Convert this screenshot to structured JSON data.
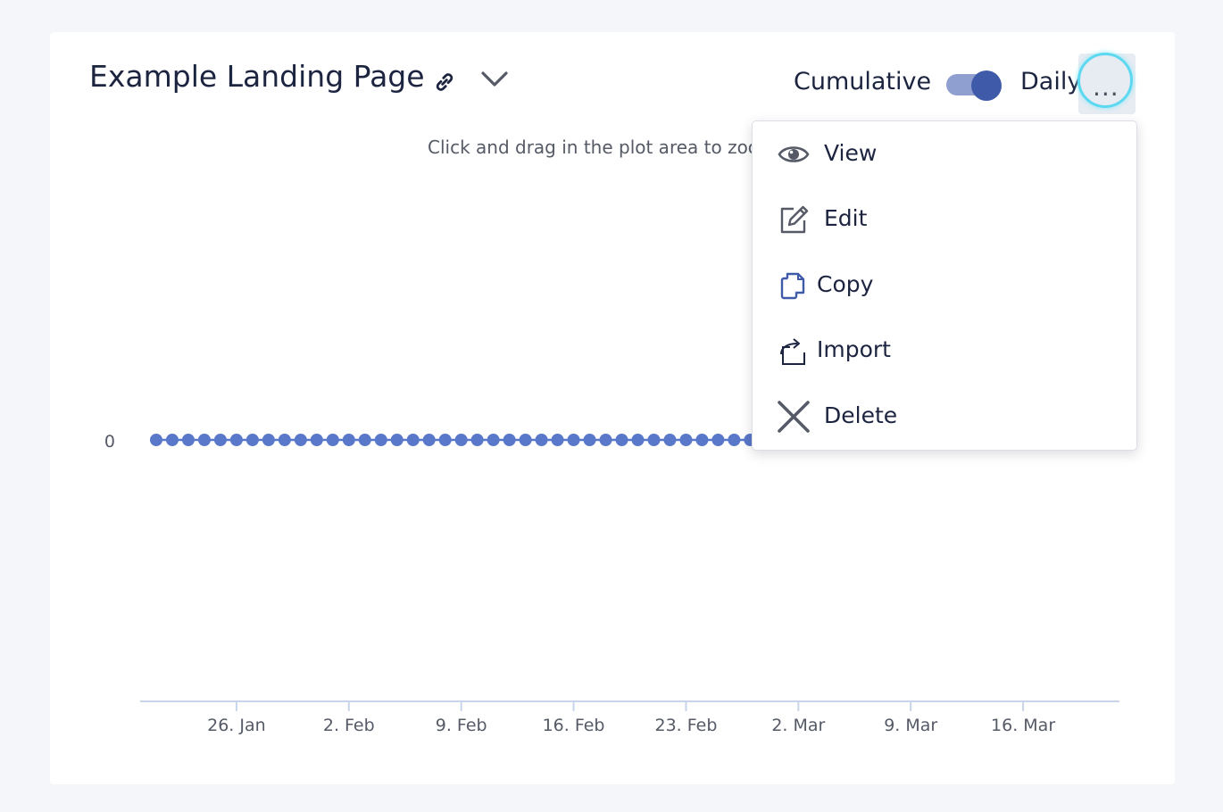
{
  "header": {
    "title": "Example Landing Page",
    "toggle_left_label": "Cumulative",
    "toggle_right_label": "Daily",
    "toggle_state": "Daily",
    "more_label": "..."
  },
  "colors": {
    "accent": "#3f5aa8",
    "track": "#8f9fd0",
    "series": "#5a78c9",
    "axis": "#c8d4ea",
    "focus_ring": "#5cd8f0"
  },
  "chart": {
    "hint": "Click and drag in the plot area to zoo"
  },
  "chart_data": {
    "type": "line",
    "title": "",
    "xlabel": "",
    "ylabel": "",
    "y_tick_labels": [
      "0"
    ],
    "x_tick_labels": [
      "26. Jan",
      "2. Feb",
      "9. Feb",
      "16. Feb",
      "23. Feb",
      "2. Mar",
      "9. Mar",
      "16. Mar"
    ],
    "x_start": "2025-01-20",
    "x_end": "2025-03-22",
    "visible_points_end": "2025-03-01",
    "series": [
      {
        "values_constant": 0,
        "marker": "circle"
      }
    ]
  },
  "menu": {
    "items": [
      {
        "label": "View",
        "icon": "eye-icon"
      },
      {
        "label": "Edit",
        "icon": "edit-icon"
      },
      {
        "label": "Copy",
        "icon": "copy-icon"
      },
      {
        "label": "Import",
        "icon": "import-icon"
      },
      {
        "label": "Delete",
        "icon": "close-icon"
      }
    ]
  }
}
